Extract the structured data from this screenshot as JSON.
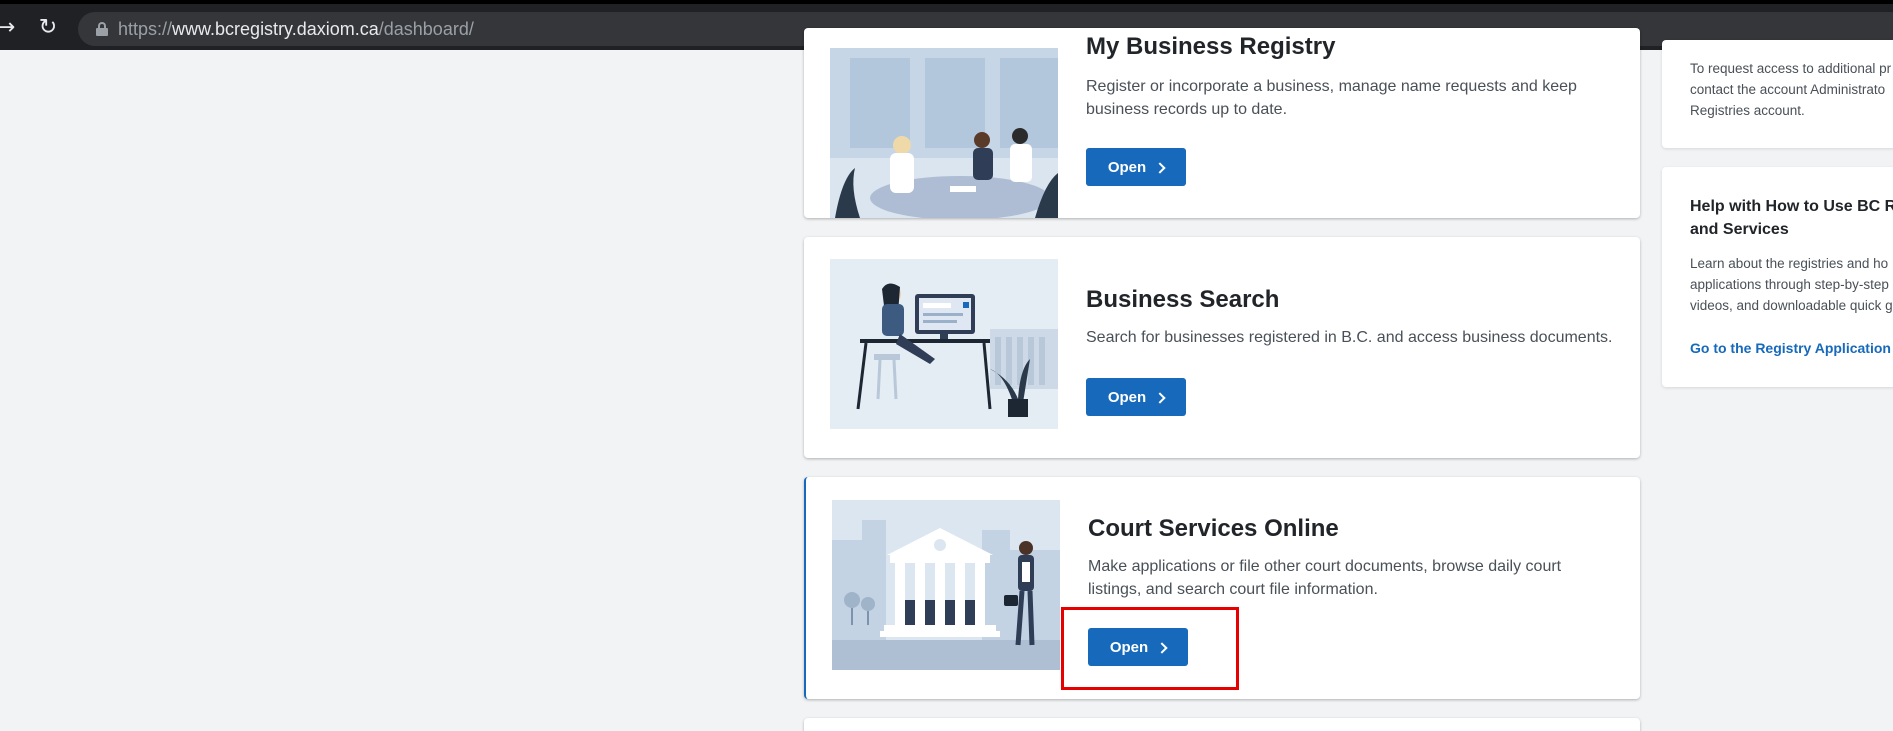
{
  "browser": {
    "url_scheme": "https://",
    "url_host": "www.bcregistry.daxiom.ca",
    "url_path": "/dashboard/"
  },
  "cards": [
    {
      "title": "My Business Registry",
      "description": "Register or incorporate a business, manage name requests and keep business records up to date.",
      "button_label": "Open"
    },
    {
      "title": "Business Search",
      "description": "Search for businesses registered in B.C. and access business documents.",
      "button_label": "Open"
    },
    {
      "title": "Court Services Online",
      "description": "Make applications or file other court documents, browse daily court listings, and search court file information.",
      "button_label": "Open"
    }
  ],
  "sidebar": {
    "access": {
      "line1": "To request access to additional pr",
      "line2": "contact the account Administrato",
      "line3": "Registries account."
    },
    "help": {
      "title_line1": "Help with How to Use BC Reg",
      "title_line2": "and Services",
      "line1": "Learn about the registries and ho",
      "line2": "applications through step-by-step",
      "line3": "videos, and downloadable quick g",
      "link": "Go to the Registry Application I"
    }
  },
  "icons": {
    "forward": "forward-arrow-icon",
    "reload": "reload-icon",
    "lock": "lock-icon",
    "chevron": "chevron-right-icon"
  },
  "colors": {
    "primary": "#1669bb",
    "highlight": "#e60000",
    "page_bg": "#f1f3f5"
  }
}
